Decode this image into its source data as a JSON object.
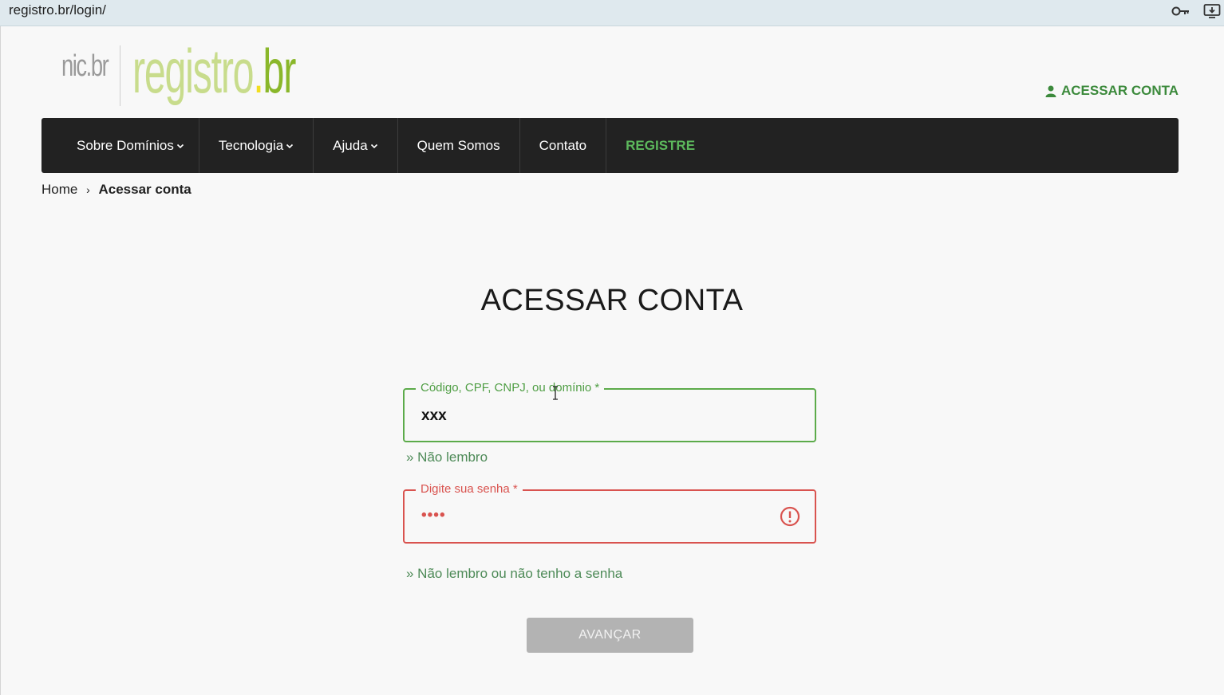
{
  "browser": {
    "url": "registro.br/login/",
    "icons": [
      "key-icon",
      "install-app-icon"
    ]
  },
  "header": {
    "logo_nic": "nic.br",
    "logo_registro": "registro",
    "logo_dot": ".",
    "logo_br": "br",
    "account_link": "ACESSAR CONTA",
    "account_icon": "user-icon"
  },
  "nav": {
    "items": [
      {
        "label": "Sobre Domínios",
        "has_dropdown": true
      },
      {
        "label": "Tecnologia",
        "has_dropdown": true
      },
      {
        "label": "Ajuda",
        "has_dropdown": true
      },
      {
        "label": "Quem Somos",
        "has_dropdown": false
      },
      {
        "label": "Contato",
        "has_dropdown": false
      },
      {
        "label": "REGISTRE",
        "has_dropdown": false
      }
    ]
  },
  "breadcrumb": {
    "home": "Home",
    "separator": "›",
    "current": "Acessar conta"
  },
  "main": {
    "title": "ACESSAR CONTA",
    "login_field": {
      "label": "Código, CPF, CNPJ, ou domínio *",
      "value": "xxx",
      "state": "valid"
    },
    "forgot_login": "» Não lembro",
    "password_field": {
      "label": "Digite sua senha *",
      "value": "••••",
      "state": "error",
      "icon": "alert-circle-icon"
    },
    "forgot_password": "» Não lembro ou não tenho a senha",
    "submit_label": "AVANÇAR"
  },
  "colors": {
    "green": "#5cab4a",
    "error": "#d9534f",
    "nav_bg": "#222222",
    "registre": "#5cb85c",
    "button_disabled": "#b3b3b3"
  }
}
